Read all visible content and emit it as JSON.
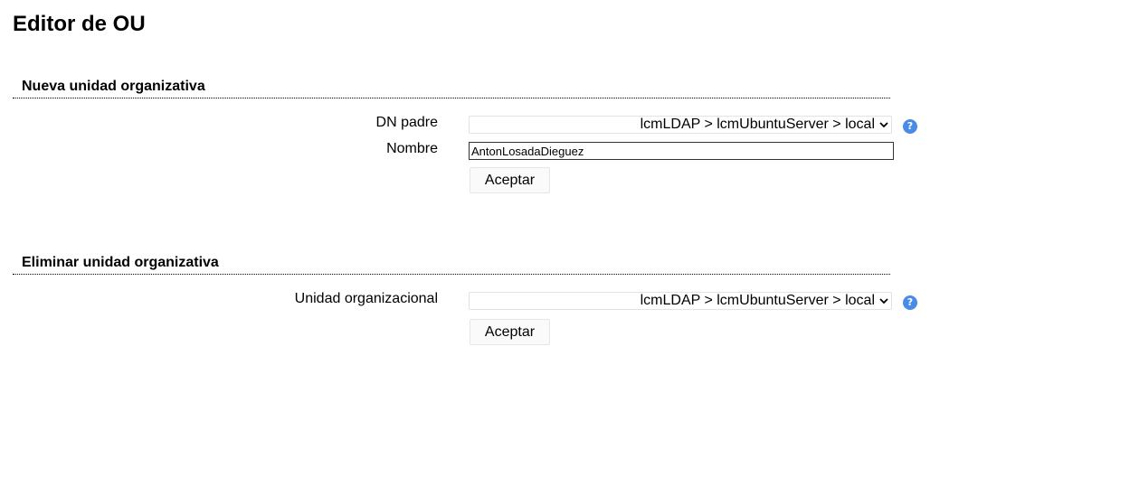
{
  "page": {
    "title": "Editor de OU"
  },
  "new_ou": {
    "section_title": "Nueva unidad organizativa",
    "parent_dn_label": "DN padre",
    "parent_dn_value": "lcmLDAP > lcmUbuntuServer > local",
    "name_label": "Nombre",
    "name_value": "AntonLosadaDieguez",
    "submit_label": "Aceptar",
    "help_glyph": "?"
  },
  "delete_ou": {
    "section_title": "Eliminar unidad organizativa",
    "ou_label": "Unidad organizacional",
    "ou_value": "lcmLDAP > lcmUbuntuServer > local",
    "submit_label": "Aceptar",
    "help_glyph": "?"
  },
  "icons": {
    "help": "help-icon",
    "dropdown": "chevron-down-icon"
  },
  "colors": {
    "help_icon": "#4a8be8"
  }
}
